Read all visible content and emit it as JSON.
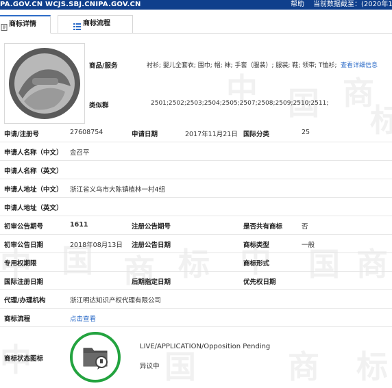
{
  "topbar": {
    "site": "PA.GOV.CN WCJS.SBJ.CNIPA.GOV.CN",
    "help": "帮助",
    "data_date": "当前数据截至：(2020年11"
  },
  "tabs": [
    {
      "label": "商标详情",
      "icon": "document-icon"
    },
    {
      "label": "商标流程",
      "icon": "list-icon"
    }
  ],
  "detail": {
    "goods_label": "商品/服务",
    "goods_value": "衬衫; 婴儿全套衣; 围巾; 帽; 袜; 手套（服装）; 服装; 鞋; 领带; T恤衫;",
    "goods_link": "查看详细信息",
    "similar_label": "类似群",
    "similar_value": "2501;2502;2503;2504;2505;2507;2508;2509;2510;2511;",
    "reg_no_label": "申请/注册号",
    "reg_no": "27608754",
    "apply_date_label": "申请日期",
    "apply_date": "2017年11月21日",
    "intl_class_label": "国际分类",
    "intl_class": "25",
    "applicant_cn_label": "申请人名称（中文）",
    "applicant_cn": "金召平",
    "applicant_en_label": "申请人名称（英文）",
    "applicant_en": "",
    "addr_cn_label": "申请人地址（中文）",
    "addr_cn": "浙江省义乌市大陈镇植林一村4组",
    "addr_en_label": "申请人地址（英文）",
    "addr_en": "",
    "prelim_no_label": "初审公告期号",
    "prelim_no": "1611",
    "reg_pub_no_label": "注册公告期号",
    "reg_pub_no": "",
    "shared_label": "是否共有商标",
    "shared": "否",
    "prelim_date_label": "初审公告日期",
    "prelim_date": "2018年08月13日",
    "reg_pub_date_label": "注册公告日期",
    "reg_pub_date": "",
    "tm_type_label": "商标类型",
    "tm_type": "一般",
    "exclusive_label": "专用权期限",
    "exclusive": "",
    "tm_form_label": "商标形式",
    "tm_form": "",
    "intl_reg_date_label": "国际注册日期",
    "later_date_label": "后期指定日期",
    "priority_date_label": "优先权日期",
    "agent_label": "代理/办理机构",
    "agent": "浙江明达知识产权代理有限公司",
    "flow_label": "商标流程",
    "flow_link": "点击查看",
    "status_label": "商标状态图标",
    "status_en": "LIVE/APPLICATION/Opposition Pending",
    "status_cn": "异议中"
  },
  "watermark": "中国商标",
  "colors": {
    "topbar": "#0f3f8c",
    "link": "#2d6cc8",
    "status_ring": "#23a33f"
  }
}
